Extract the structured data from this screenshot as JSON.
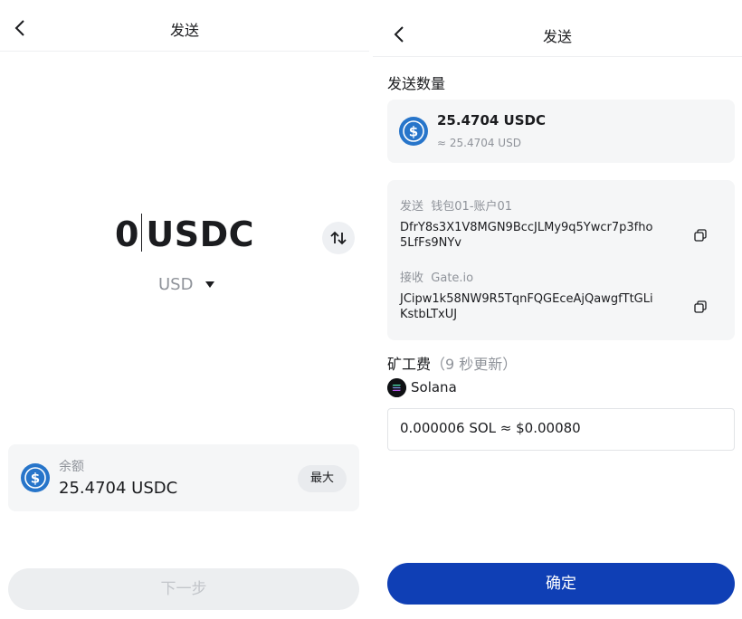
{
  "left": {
    "header": {
      "title": "发送"
    },
    "amount": {
      "value": "0",
      "currency": "USDC"
    },
    "unit_selector": {
      "value": "USD"
    },
    "balance": {
      "label": "余额",
      "value": "25.4704 USDC",
      "max_label": "最大"
    },
    "next_button": {
      "label": "下一步",
      "state": "disabled"
    }
  },
  "right": {
    "header": {
      "title": "发送"
    },
    "send_amount": {
      "title": "发送数量",
      "amount": "25.4704 USDC",
      "fiat": "≈ 25.4704 USD"
    },
    "transfer": {
      "from_label": "发送",
      "from_name": "钱包01-账户01",
      "from_address_line1": "DfrY8s3X1V8MGN9BccJLMy9q5Ywcr7p3fho",
      "from_address_line2": "5LfFs9NYv",
      "to_label": "接收",
      "to_name": "Gate.io",
      "to_address_line1": "JCipw1k58NW9R5TqnFQGEceAjQawgfTtGLi",
      "to_address_line2": "KstbLTxUJ"
    },
    "fee": {
      "title": "矿工费",
      "refresh_note": "（9 秒更新）",
      "network": "Solana",
      "value": "0.000006 SOL ≈ $0.00080"
    },
    "confirm_button": {
      "label": "确定"
    }
  },
  "colors": {
    "accent": "#0f3fb5",
    "usdc_blue": "#2775ca",
    "card_bg": "#f5f6f7"
  },
  "icons": [
    "back-arrow-icon",
    "swap-icon",
    "dropdown-triangle-icon",
    "usdc-coin-icon",
    "copy-icon",
    "solana-icon"
  ]
}
